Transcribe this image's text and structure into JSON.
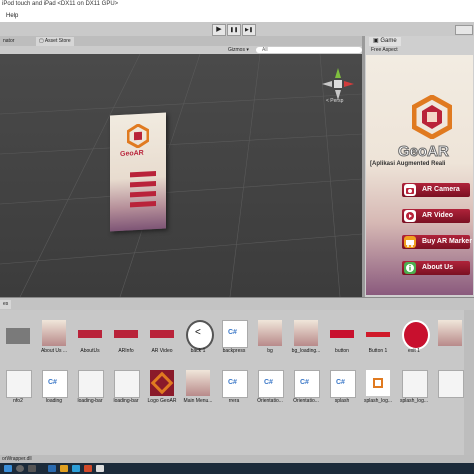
{
  "window": {
    "title": "iPod touch and iPad <DX11 on DX11 GPU>"
  },
  "menu": {
    "help": "Help"
  },
  "toolbar": {
    "play": "▶",
    "pause": "❚❚",
    "step": "▶❚"
  },
  "tabs": {
    "left": "nator",
    "asset_store": "Asset Store"
  },
  "scene_bar": {
    "gizmos": "Gizmos ▾",
    "search": "All"
  },
  "scene": {
    "persp_label": "< Persp"
  },
  "game_panel": {
    "tab": "Game",
    "aspect": "Free Aspect"
  },
  "app": {
    "title": "GeoAR",
    "subtitle": "[Aplikasi Augmented Reali",
    "buttons": [
      {
        "label": "AR Camera",
        "color": "#b9233a"
      },
      {
        "label": "AR Video",
        "color": "#b9233a"
      },
      {
        "label": "Buy AR Marker",
        "color": "#b9233a"
      },
      {
        "label": "About Us",
        "color": "#b9233a"
      }
    ]
  },
  "project": {
    "tab": "es",
    "assets_row1": [
      {
        "label": "",
        "kind": "folder"
      },
      {
        "label": "About Us ...",
        "kind": "image"
      },
      {
        "label": "AboutUs",
        "kind": "button-red"
      },
      {
        "label": "ARInfo",
        "kind": "button-red"
      },
      {
        "label": "AR Video",
        "kind": "button-red"
      },
      {
        "label": "back 1",
        "kind": "back"
      },
      {
        "label": "backpress",
        "kind": "script"
      },
      {
        "label": "bg",
        "kind": "image"
      },
      {
        "label": "bg_loading...",
        "kind": "image"
      },
      {
        "label": "button",
        "kind": "play-red"
      },
      {
        "label": "Button 1",
        "kind": "red-bar"
      },
      {
        "label": "exit 1",
        "kind": "exit"
      },
      {
        "label": "",
        "kind": "image"
      }
    ],
    "assets_row2": [
      {
        "label": "nfo2",
        "kind": "file"
      },
      {
        "label": "loading",
        "kind": "script"
      },
      {
        "label": "loading-bar",
        "kind": "file"
      },
      {
        "label": "loading-bar",
        "kind": "file"
      },
      {
        "label": "Logo GeoAR",
        "kind": "logo"
      },
      {
        "label": "Main Menu...",
        "kind": "image"
      },
      {
        "label": "rrera",
        "kind": "script"
      },
      {
        "label": "Orientatio...",
        "kind": "script"
      },
      {
        "label": "Orientatio...",
        "kind": "script"
      },
      {
        "label": "splash",
        "kind": "script"
      },
      {
        "label": "splash_log...",
        "kind": "logo-small"
      },
      {
        "label": "splash_log...",
        "kind": "file"
      },
      {
        "label": "",
        "kind": "file"
      }
    ]
  },
  "status": {
    "text": "orWrapper.dll"
  }
}
